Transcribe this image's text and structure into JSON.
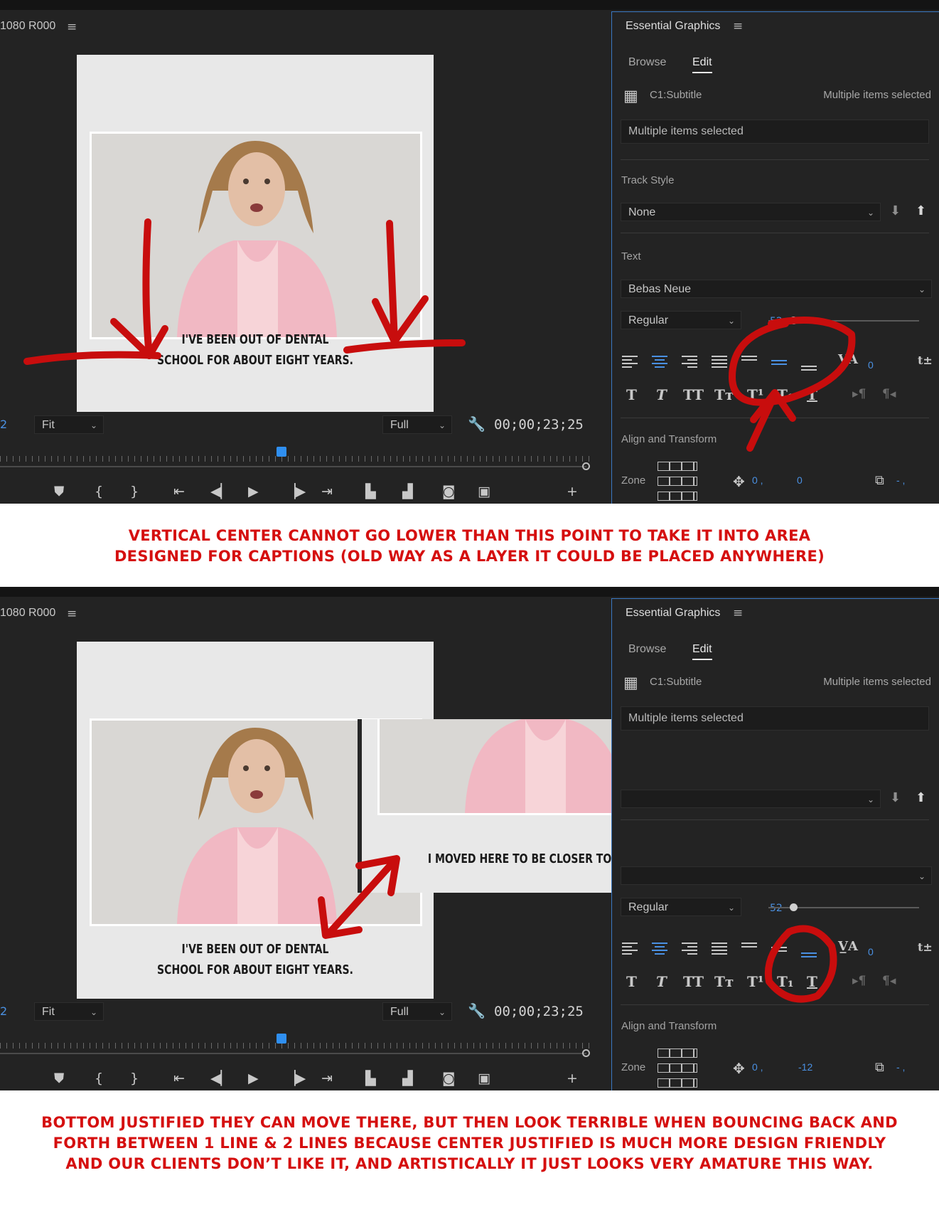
{
  "colors": {
    "panel_bg": "#232323",
    "accent_blue": "#4a90e2",
    "annotation_red": "#d50f0f"
  },
  "screens": [
    {
      "monitor": {
        "sequence_title": "1080 R000",
        "menu_icon": "hamburger-icon",
        "caption_lines": [
          "I'VE BEEN OUT OF DENTAL",
          "SCHOOL FOR ABOUT EIGHT YEARS."
        ],
        "page_number": "2",
        "zoom_select": "Fit",
        "quality_select": "Full",
        "timecode": "00;00;23;25",
        "playhead_progress": 0.48
      },
      "essential_graphics": {
        "title": "Essential Graphics",
        "tabs": [
          "Browse",
          "Edit"
        ],
        "active_tab": "Edit",
        "layer_name": "C1:Subtitle",
        "layer_info": "Multiple items selected",
        "text_value": "Multiple items selected",
        "track_style_label": "Track Style",
        "track_style_value": "None",
        "text_label": "Text",
        "font_family": "Bebas Neue",
        "font_style": "Regular",
        "font_size": "52",
        "tracking_value": "0",
        "align_label": "Align and Transform",
        "zone_label": "Zone",
        "position_x": "0 ,",
        "position_y": "0",
        "scale_value": "- ,",
        "active_vertical_align": "center"
      }
    },
    {
      "monitor": {
        "sequence_title": "1080 R000",
        "menu_icon": "hamburger-icon",
        "caption_lines": [
          "I'VE BEEN OUT OF DENTAL",
          "SCHOOL FOR ABOUT EIGHT YEARS."
        ],
        "inset_caption": "I MOVED HERE TO BE CLOSER TO FAMILY.",
        "page_number": "2",
        "zoom_select": "Fit",
        "quality_select": "Full",
        "timecode": "00;00;23;25",
        "playhead_progress": 0.48
      },
      "essential_graphics": {
        "title": "Essential Graphics",
        "tabs": [
          "Browse",
          "Edit"
        ],
        "active_tab": "Edit",
        "layer_name": "C1:Subtitle",
        "layer_info": "Multiple items selected",
        "text_value": "Multiple items selected",
        "font_style": "Regular",
        "font_size": "52",
        "tracking_value": "0",
        "align_label": "Align and Transform",
        "zone_label": "Zone",
        "position_x": "0 ,",
        "position_y": "-12",
        "scale_value": "- ,",
        "active_vertical_align": "bottom"
      }
    }
  ],
  "annotations": {
    "note1_lines": [
      "VERTICAL CENTER CANNOT GO LOWER THAN THIS POINT TO TAKE IT INTO AREA",
      "DESIGNED FOR CAPTIONS (OLD WAY AS A LAYER IT COULD BE PLACED ANYWHERE)"
    ],
    "note2_lines": [
      "BOTTOM JUSTIFIED THEY CAN MOVE THERE, BUT THEN LOOK TERRIBLE WHEN BOUNCING BACK AND",
      "FORTH BETWEEN 1 LINE & 2 LINES BECAUSE CENTER JUSTIFIED IS MUCH MORE DESIGN FRIENDLY",
      "AND OUR CLIENTS DON’T LIKE IT, AND ARTISTICALLY IT JUST LOOKS VERY AMATURE THIS WAY."
    ]
  }
}
